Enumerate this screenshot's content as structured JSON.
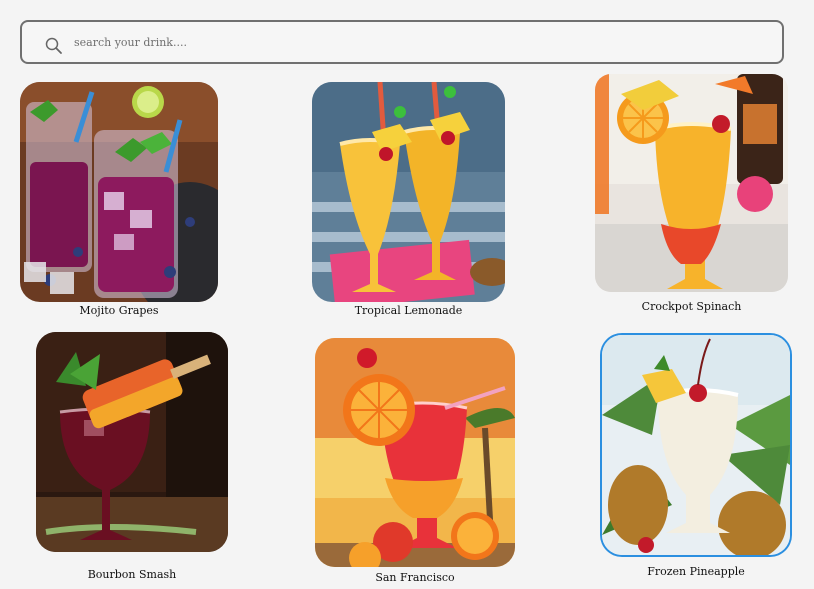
{
  "search": {
    "placeholder": "search your drink....",
    "value": "",
    "icon": "search-icon"
  },
  "drinks": [
    {
      "name": "Mojito Grapes",
      "selected": false
    },
    {
      "name": "Tropical Lemonade",
      "selected": false
    },
    {
      "name": "Crockpot Spinach",
      "selected": false
    },
    {
      "name": "Bourbon Smash",
      "selected": false
    },
    {
      "name": "San Francisco",
      "selected": false
    },
    {
      "name": "Frozen Pineapple",
      "selected": true
    }
  ],
  "colors": {
    "background": "#f4f4f4",
    "search_border": "#707070",
    "selected_border": "#2b8fe0"
  }
}
